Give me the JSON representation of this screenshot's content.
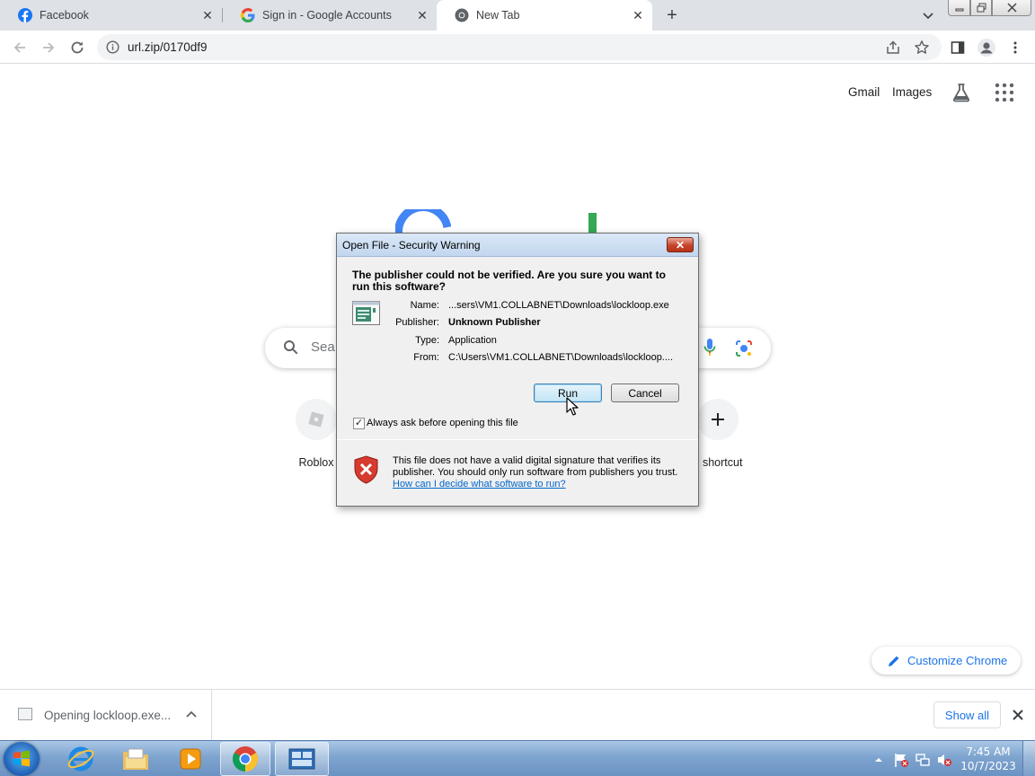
{
  "browser": {
    "tabs": [
      {
        "title": "Facebook",
        "icon": "facebook-icon"
      },
      {
        "title": "Sign in - Google Accounts",
        "icon": "google-icon"
      },
      {
        "title": "New Tab",
        "icon": "chrome-icon"
      }
    ],
    "active_tab": 2,
    "address": "url.zip/0170df9"
  },
  "ntp": {
    "gmail": "Gmail",
    "images": "Images",
    "search_placeholder": "Sea",
    "shortcuts": [
      {
        "label": "Roblox"
      },
      {
        "label": "d shortcut"
      }
    ],
    "customize": "Customize Chrome"
  },
  "download_shelf": {
    "item": "Opening lockloop.exe...",
    "show_all": "Show all"
  },
  "dialog": {
    "title": "Open File - Security Warning",
    "question": "The publisher could not be verified.  Are you sure you want to run this software?",
    "fields": [
      {
        "label": "Name:",
        "value": "...sers\\VM1.COLLABNET\\Downloads\\lockloop.exe",
        "bold": false
      },
      {
        "label": "Publisher:",
        "value": "Unknown Publisher",
        "bold": true
      },
      {
        "label": "Type:",
        "value": "Application",
        "bold": false
      },
      {
        "label": "From:",
        "value": "C:\\Users\\VM1.COLLABNET\\Downloads\\lockloop....",
        "bold": false
      }
    ],
    "run_label": "Run",
    "cancel_label": "Cancel",
    "checkbox_label": "Always ask before opening this file",
    "checkbox_checked": true,
    "warning": "This file does not have a valid digital signature that verifies its publisher.  You should only run software from publishers you trust.",
    "help_link": "How can I decide what software to run?"
  },
  "taskbar": {
    "time": "7:45 AM",
    "date": "10/7/2023"
  },
  "colors": {
    "accent": "#1a73e8",
    "tabstrip": "#dee1e6",
    "dialog_bg": "#f0f0f0",
    "taskbar": "#7ea4cf"
  }
}
